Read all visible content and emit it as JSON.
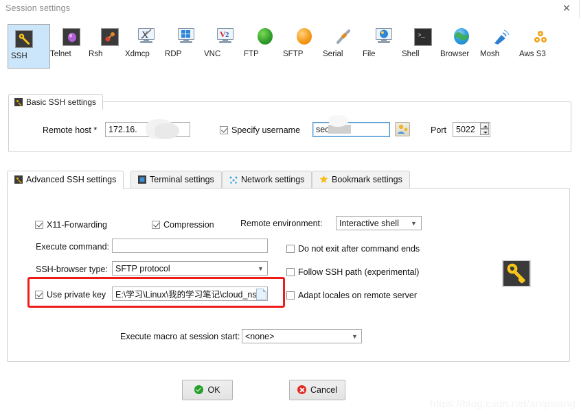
{
  "window": {
    "title": "Session settings",
    "close_label": "✕"
  },
  "protocols": [
    {
      "label": "SSH",
      "icon": "ssh-key-icon"
    },
    {
      "label": "Telnet",
      "icon": "telnet-icon"
    },
    {
      "label": "Rsh",
      "icon": "rsh-icon"
    },
    {
      "label": "Xdmcp",
      "icon": "xdmcp-monitor-icon"
    },
    {
      "label": "RDP",
      "icon": "rdp-monitor-icon"
    },
    {
      "label": "VNC",
      "icon": "vnc-monitor-icon"
    },
    {
      "label": "FTP",
      "icon": "ftp-globe-icon"
    },
    {
      "label": "SFTP",
      "icon": "sftp-globe-icon"
    },
    {
      "label": "Serial",
      "icon": "serial-plug-icon"
    },
    {
      "label": "File",
      "icon": "file-monitor-icon"
    },
    {
      "label": "Shell",
      "icon": "shell-terminal-icon"
    },
    {
      "label": "Browser",
      "icon": "browser-globe-icon"
    },
    {
      "label": "Mosh",
      "icon": "mosh-satellite-icon"
    },
    {
      "label": "Aws S3",
      "icon": "aws-s3-icon"
    }
  ],
  "selected_protocol": "SSH",
  "basic_ssh": {
    "group_title": "Basic SSH settings",
    "remote_host_label": "Remote host *",
    "remote_host_value": "172.16.",
    "specify_username_label": "Specify username",
    "specify_username_checked": true,
    "username_value": "sec",
    "port_label": "Port",
    "port_value": "5022",
    "user_picker_icon": "user-picker-icon"
  },
  "tabs": [
    {
      "label": "Advanced SSH settings",
      "icon": "ssh-key-icon",
      "active": true
    },
    {
      "label": "Terminal settings",
      "icon": "terminal-icon",
      "active": false
    },
    {
      "label": "Network settings",
      "icon": "network-icon",
      "active": false
    },
    {
      "label": "Bookmark settings",
      "icon": "star-icon",
      "active": false
    }
  ],
  "advanced": {
    "x11_label": "X11-Forwarding",
    "x11_checked": true,
    "compression_label": "Compression",
    "compression_checked": true,
    "remote_env_label": "Remote environment:",
    "remote_env_value": "Interactive shell",
    "execute_command_label": "Execute command:",
    "execute_command_value": "",
    "ssh_browser_label": "SSH-browser type:",
    "ssh_browser_value": "SFTP protocol",
    "use_private_key_label": "Use private key",
    "use_private_key_checked": true,
    "private_key_value": "E:\\学习\\Linux\\我的学习笔记\\cloud_ns",
    "do_not_exit_label": "Do not exit after command ends",
    "do_not_exit_checked": false,
    "follow_ssh_path_label": "Follow SSH path (experimental)",
    "follow_ssh_path_checked": false,
    "adapt_locales_label": "Adapt locales on remote server",
    "adapt_locales_checked": false,
    "macro_label": "Execute macro at session start:",
    "macro_value": "<none>",
    "key_icon": "big-key-icon"
  },
  "footer": {
    "ok_label": "OK",
    "cancel_label": "Cancel"
  },
  "watermark": "https://blog.csdn.net/anqixiang",
  "colors": {
    "selection": "#cbe5fa",
    "highlight": "#ee1c19",
    "accent_key": "#f5c518"
  }
}
